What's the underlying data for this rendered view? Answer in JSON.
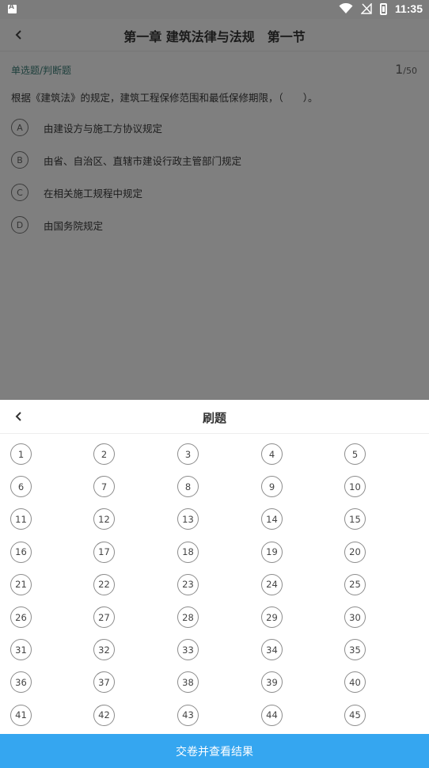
{
  "status_bar": {
    "time": "11:35"
  },
  "page": {
    "title": "第一章 建筑法律与法规　第一节"
  },
  "question": {
    "type_label": "单选题/判断题",
    "current": "1",
    "total": "/50",
    "text": "根据《建筑法》的规定，建筑工程保修范围和最低保修期限，（　　）。",
    "options": [
      {
        "letter": "A",
        "text": "由建设方与施工方协议规定"
      },
      {
        "letter": "B",
        "text": "由省、自治区、直辖市建设行政主管部门规定"
      },
      {
        "letter": "C",
        "text": "在相关施工规程中规定"
      },
      {
        "letter": "D",
        "text": "由国务院规定"
      }
    ]
  },
  "sheet": {
    "title": "刷题",
    "numbers": [
      "1",
      "2",
      "3",
      "4",
      "5",
      "6",
      "7",
      "8",
      "9",
      "10",
      "11",
      "12",
      "13",
      "14",
      "15",
      "16",
      "17",
      "18",
      "19",
      "20",
      "21",
      "22",
      "23",
      "24",
      "25",
      "26",
      "27",
      "28",
      "29",
      "30",
      "31",
      "32",
      "33",
      "34",
      "35",
      "36",
      "37",
      "38",
      "39",
      "40",
      "41",
      "42",
      "43",
      "44",
      "45"
    ],
    "submit_label": "交卷并查看结果"
  },
  "colors": {
    "accent": "#35a6f0",
    "overlay": "#7f7f7f"
  }
}
